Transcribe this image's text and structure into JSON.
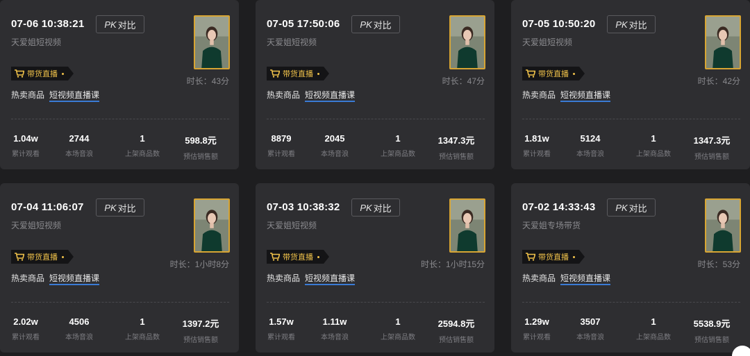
{
  "cards": [
    {
      "date": "07-06 10:38:21",
      "pk": "PK 对比",
      "pk_italic": "PK",
      "pk_text": "对比",
      "account": "天爱姐短视频",
      "live_tag": "带货直播",
      "duration": "时长：43分",
      "hot_label": "热卖商品",
      "hot_link": "短视频直播课",
      "stats": [
        {
          "value": "1.04w",
          "label": "累计观看"
        },
        {
          "value": "2744",
          "label": "本场音浪"
        },
        {
          "value": "1",
          "label": "上架商品数"
        },
        {
          "value": "598.8元",
          "label": "预估销售额"
        }
      ]
    },
    {
      "date": "07-05 17:50:06",
      "pk": "PK 对比",
      "pk_italic": "PK",
      "pk_text": "对比",
      "account": "天爱姐短视频",
      "live_tag": "带货直播",
      "duration": "时长：47分",
      "hot_label": "热卖商品",
      "hot_link": "短视频直播课",
      "stats": [
        {
          "value": "8879",
          "label": "累计观看"
        },
        {
          "value": "2045",
          "label": "本场音浪"
        },
        {
          "value": "1",
          "label": "上架商品数"
        },
        {
          "value": "1347.3元",
          "label": "预估销售额"
        }
      ]
    },
    {
      "date": "07-05 10:50:20",
      "pk": "PK 对比",
      "pk_italic": "PK",
      "pk_text": "对比",
      "account": "天爱姐短视频",
      "live_tag": "带货直播",
      "duration": "时长：42分",
      "hot_label": "热卖商品",
      "hot_link": "短视频直播课",
      "stats": [
        {
          "value": "1.81w",
          "label": "累计观看"
        },
        {
          "value": "5124",
          "label": "本场音浪"
        },
        {
          "value": "1",
          "label": "上架商品数"
        },
        {
          "value": "1347.3元",
          "label": "预估销售额"
        }
      ]
    },
    {
      "date": "07-04 11:06:07",
      "pk": "PK 对比",
      "pk_italic": "PK",
      "pk_text": "对比",
      "account": "天爱姐短视频",
      "live_tag": "带货直播",
      "duration": "时长：1小时8分",
      "hot_label": "热卖商品",
      "hot_link": "短视频直播课",
      "stats": [
        {
          "value": "2.02w",
          "label": "累计观看"
        },
        {
          "value": "4506",
          "label": "本场音浪"
        },
        {
          "value": "1",
          "label": "上架商品数"
        },
        {
          "value": "1397.2元",
          "label": "预估销售额"
        }
      ]
    },
    {
      "date": "07-03 10:38:32",
      "pk": "PK 对比",
      "pk_italic": "PK",
      "pk_text": "对比",
      "account": "天爱姐短视频",
      "live_tag": "带货直播",
      "duration": "时长：1小时15分",
      "hot_label": "热卖商品",
      "hot_link": "短视频直播课",
      "stats": [
        {
          "value": "1.57w",
          "label": "累计观看"
        },
        {
          "value": "1.11w",
          "label": "本场音浪"
        },
        {
          "value": "1",
          "label": "上架商品数"
        },
        {
          "value": "2594.8元",
          "label": "预估销售额"
        }
      ]
    },
    {
      "date": "07-02 14:33:43",
      "pk": "PK 对比",
      "pk_italic": "PK",
      "pk_text": "对比",
      "account": "天爱姐专场带货",
      "live_tag": "带货直播",
      "duration": "时长：53分",
      "hot_label": "热卖商品",
      "hot_link": "短视频直播课",
      "stats": [
        {
          "value": "1.29w",
          "label": "累计观看"
        },
        {
          "value": "3507",
          "label": "本场音浪"
        },
        {
          "value": "1",
          "label": "上架商品数"
        },
        {
          "value": "5538.9元",
          "label": "预估销售额"
        }
      ]
    }
  ],
  "colors": {
    "accent_gold": "#f0c24a",
    "thumb_border": "#d8a533",
    "link_underline": "#3a7bd5",
    "card_bg": "#2e2e31",
    "page_bg": "#1e1e20"
  },
  "icons": {
    "live_tag": "shopping-cart-icon"
  }
}
